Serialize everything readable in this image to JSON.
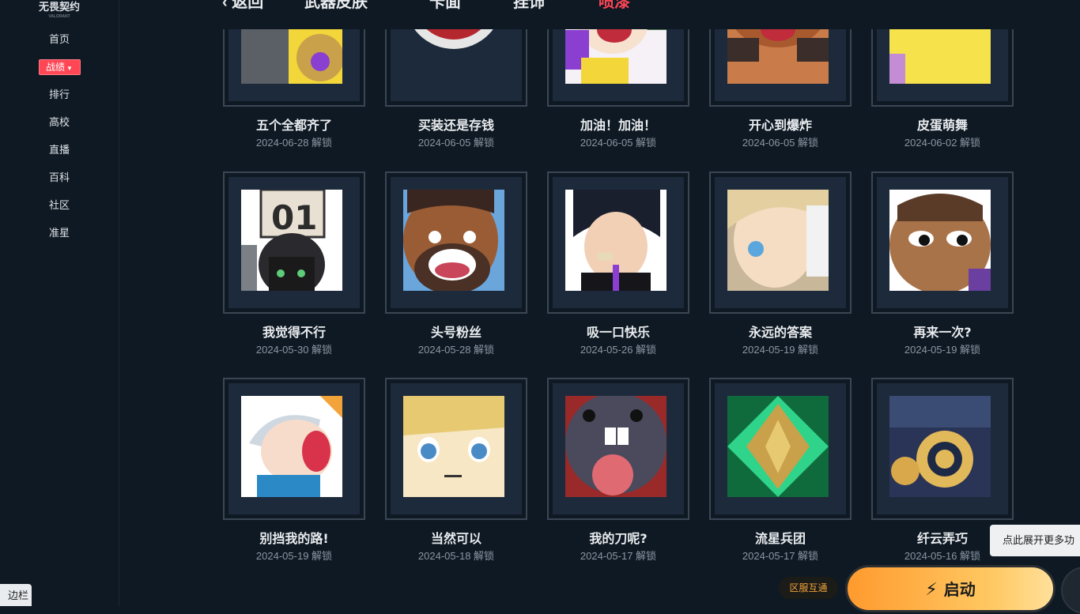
{
  "app": {
    "logo": "无畏契约",
    "logo_sub": "VALORANT"
  },
  "sidebar": {
    "items": [
      {
        "label": "首页"
      },
      {
        "label": "战绩"
      },
      {
        "label": "排行"
      },
      {
        "label": "高校"
      },
      {
        "label": "直播"
      },
      {
        "label": "百科"
      },
      {
        "label": "社区"
      },
      {
        "label": "准星"
      }
    ],
    "active_index": 1,
    "toggle_label": "边栏"
  },
  "tabs": {
    "back": "返回",
    "items": [
      "武器皮肤",
      "卡面",
      "挂饰",
      "喷漆"
    ],
    "active": "喷漆"
  },
  "sprays": [
    {
      "name": "五个全都齐了",
      "date": "2024-06-28",
      "status": "解锁"
    },
    {
      "name": "买装还是存钱",
      "date": "2024-06-05",
      "status": "解锁"
    },
    {
      "name": "加油！加油！",
      "date": "2024-06-05",
      "status": "解锁"
    },
    {
      "name": "开心到爆炸",
      "date": "2024-06-05",
      "status": "解锁"
    },
    {
      "name": "皮蛋萌舞",
      "date": "2024-06-02",
      "status": "解锁"
    },
    {
      "name": "我觉得不行",
      "date": "2024-05-30",
      "status": "解锁"
    },
    {
      "name": "头号粉丝",
      "date": "2024-05-28",
      "status": "解锁"
    },
    {
      "name": "吸一口快乐",
      "date": "2024-05-26",
      "status": "解锁"
    },
    {
      "name": "永远的答案",
      "date": "2024-05-19",
      "status": "解锁"
    },
    {
      "name": "再来一次?",
      "date": "2024-05-19",
      "status": "解锁"
    },
    {
      "name": "别挡我的路!",
      "date": "2024-05-19",
      "status": "解锁"
    },
    {
      "name": "当然可以",
      "date": "2024-05-18",
      "status": "解锁"
    },
    {
      "name": "我的刀呢?",
      "date": "2024-05-17",
      "status": "解锁"
    },
    {
      "name": "流星兵团",
      "date": "2024-05-17",
      "status": "解锁"
    },
    {
      "name": "纤云弄巧",
      "date": "2024-05-16",
      "status": "解锁"
    }
  ],
  "footer": {
    "region_label": "区服互通",
    "launch_label": "启动",
    "tooltip": "点此展开更多功"
  },
  "colors": {
    "accent": "#ff4655",
    "background": "#0f1923",
    "launch": "#ffb347"
  }
}
